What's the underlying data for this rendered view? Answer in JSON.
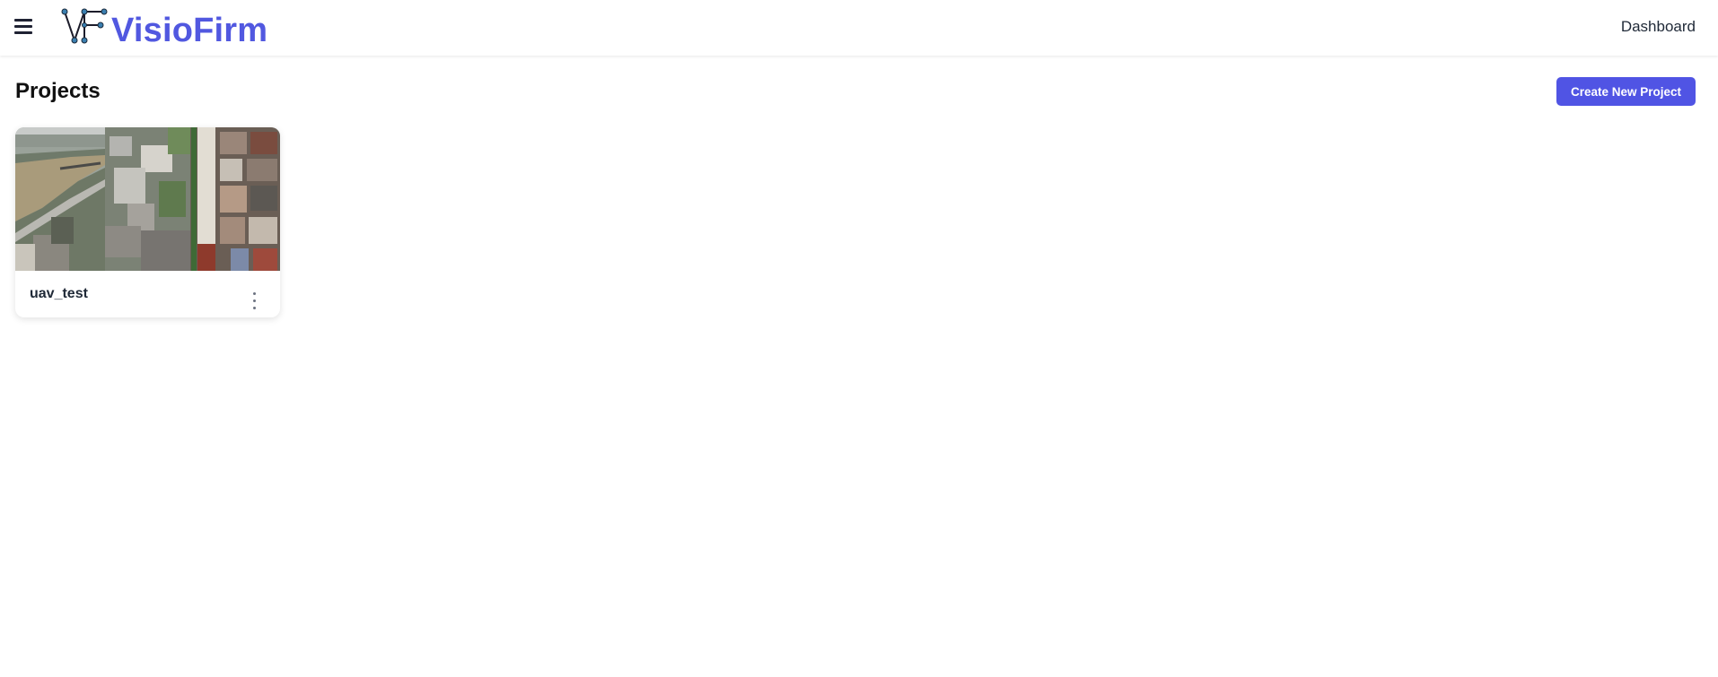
{
  "header": {
    "brand": "VisioFirm",
    "brand_color": "#5158e0",
    "menu_icon": "hamburger-menu-icon",
    "logo_icon": "vf-logo-icon",
    "nav": {
      "dashboard_label": "Dashboard"
    }
  },
  "main": {
    "title": "Projects",
    "create_button_label": "Create New Project",
    "accent_color": "#5054e4",
    "projects": [
      {
        "name": "uav_test",
        "thumbnail": "aerial-town-river-thumbnail",
        "menu_icon": "more-vertical-icon"
      }
    ]
  }
}
